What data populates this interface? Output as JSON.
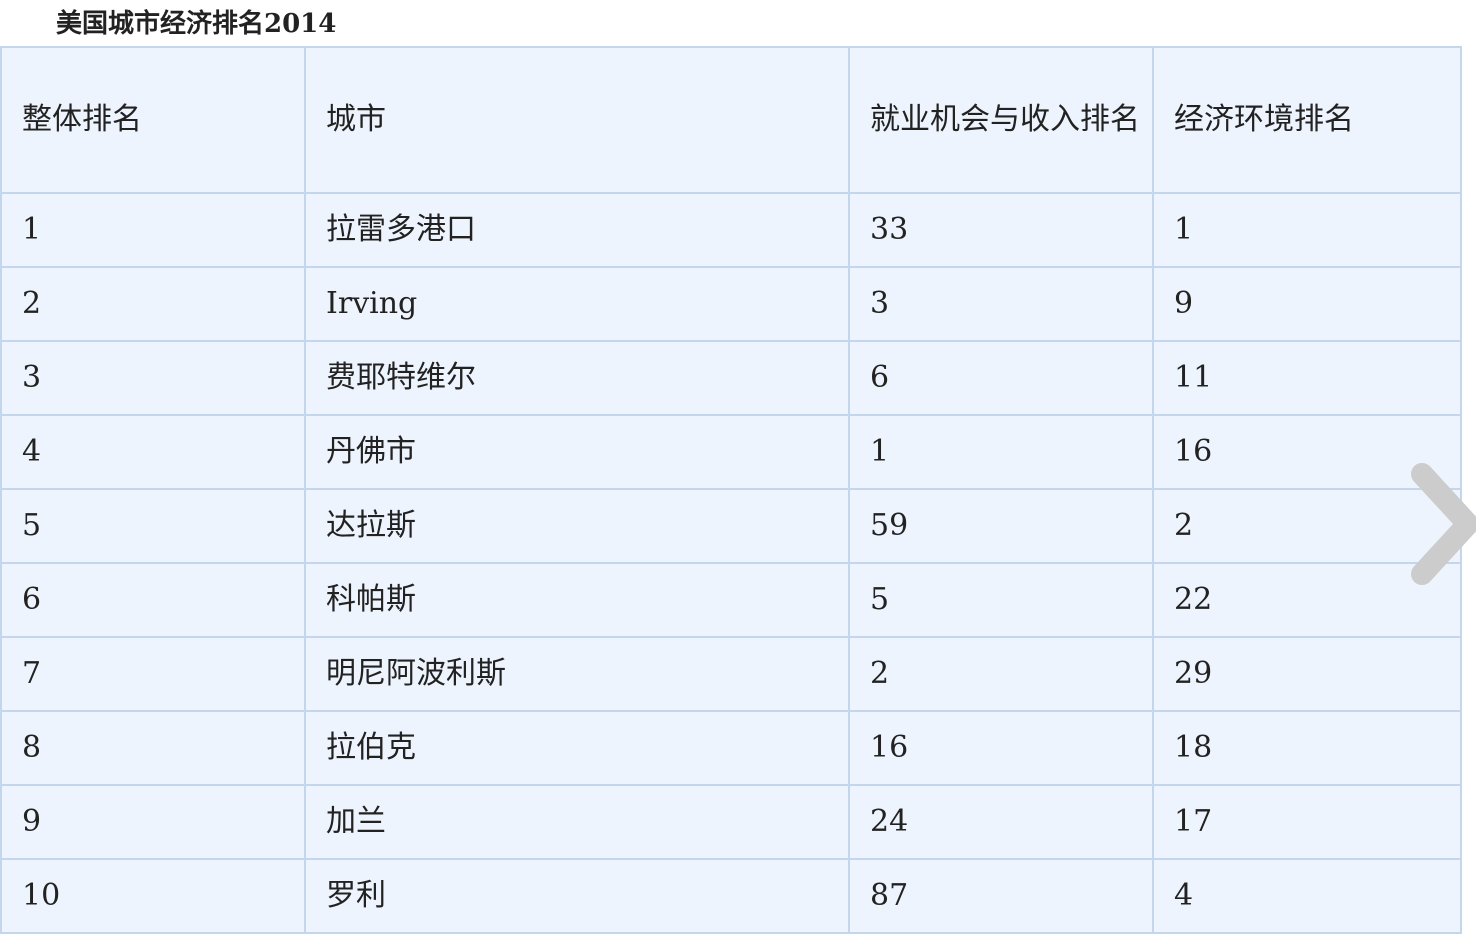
{
  "caption": "美国城市经济排名2014",
  "table": {
    "headers": [
      "整体排名",
      "城市",
      "就业机会与收入排名",
      "经济环境排名"
    ],
    "rows": [
      [
        "1",
        "拉雷多港口",
        "33",
        "1"
      ],
      [
        "2",
        "Irving",
        "3",
        "9"
      ],
      [
        "3",
        "费耶特维尔",
        "6",
        "11"
      ],
      [
        "4",
        "丹佛市",
        "1",
        "16"
      ],
      [
        "5",
        "达拉斯",
        "59",
        "2"
      ],
      [
        "6",
        "科帕斯",
        "5",
        "22"
      ],
      [
        "7",
        "明尼阿波利斯",
        "2",
        "29"
      ],
      [
        "8",
        "拉伯克",
        "16",
        "18"
      ],
      [
        "9",
        "加兰",
        "24",
        "17"
      ],
      [
        "10",
        "罗利",
        "87",
        "4"
      ]
    ]
  },
  "icons": {
    "next": "chevron-right-icon"
  },
  "colors": {
    "table_bg": "#eef4fd",
    "border": "#c3d6ec",
    "arrow": "#cccccc"
  }
}
